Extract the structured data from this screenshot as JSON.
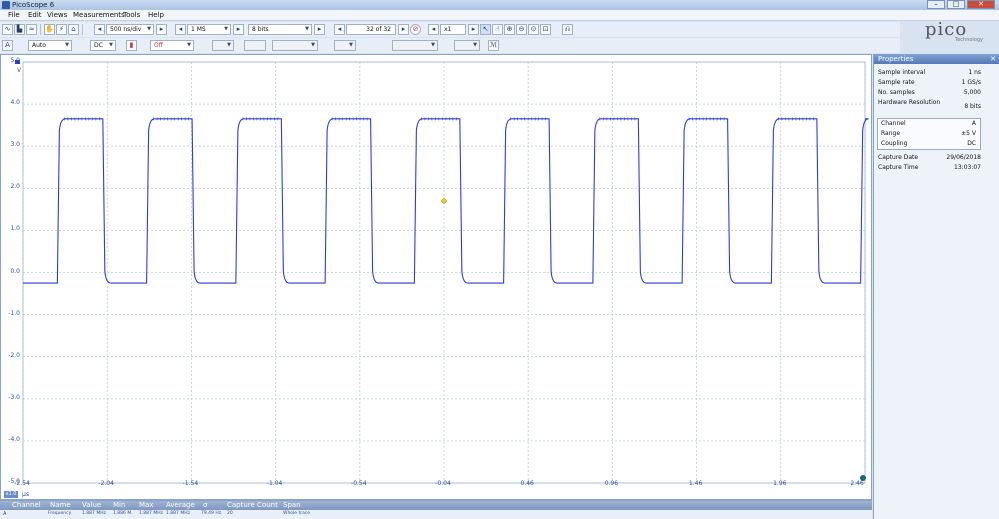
{
  "window": {
    "title": "PicoScope 6"
  },
  "menu": {
    "items": [
      "File",
      "Edit",
      "Views",
      "Measurements",
      "Tools",
      "Help"
    ]
  },
  "logo": {
    "text": "pico",
    "sub": "Technology"
  },
  "toolbar": {
    "timebase": "500 ns/div",
    "samples": "1 MS",
    "resolution": "8 bits",
    "buffer": "32 of 32",
    "zoom": "x1"
  },
  "channel_bar": {
    "channel": "A",
    "range": "Auto",
    "coupling": "DC",
    "trigger": "Off"
  },
  "properties": {
    "title": "Properties",
    "rows": [
      {
        "label": "Sample interval",
        "value": "1 ns"
      },
      {
        "label": "Sample rate",
        "value": "1 GS/s"
      },
      {
        "label": "No. samples",
        "value": "5,000"
      },
      {
        "label": "Hardware Resolution",
        "value": "8 bits"
      }
    ],
    "channel_box": [
      {
        "label": "Channel",
        "value": "A"
      },
      {
        "label": "Range",
        "value": "±5 V"
      },
      {
        "label": "Coupling",
        "value": "DC"
      }
    ],
    "capture": [
      {
        "label": "Capture Date",
        "value": "29/06/2018"
      },
      {
        "label": "Capture Time",
        "value": "13:03:07"
      }
    ]
  },
  "measurements": {
    "headers": [
      "Channel",
      "Name",
      "Value",
      "Min",
      "Max",
      "Average",
      "σ",
      "Capture Count",
      "Span"
    ],
    "row": [
      "A",
      "Frequency",
      "1.887 MHz",
      "1.886 M.",
      "1.887 MHz",
      "1.887 MHz",
      "79.49 Hz",
      "20",
      "Whole trace"
    ]
  },
  "axis": {
    "y_unit": "V",
    "x_unit": "µs",
    "zoom_tag": "x1.0",
    "yticks": [
      "5.0",
      "4.0",
      "3.0",
      "2.0",
      "1.0",
      "0.0",
      "-1.0",
      "-2.0",
      "-3.0",
      "-4.0",
      "-5.0"
    ],
    "xticks": [
      "-2.54",
      "-2.04",
      "-1.54",
      "-1.04",
      "-0.54",
      "-0.04",
      "0.46",
      "0.96",
      "1.46",
      "1.96",
      "2.46"
    ]
  },
  "colors": {
    "trace": "#2a3ed6",
    "grid": "#b7d3d1",
    "trigger": "#e8c838"
  },
  "chart_data": {
    "type": "line",
    "series": [
      {
        "name": "A",
        "high": 3.65,
        "low": -0.25,
        "frequency_mhz": 1.887,
        "rising_edges_us": [
          -2.33,
          -1.8,
          -1.27,
          -0.74,
          -0.21,
          0.32,
          0.85,
          1.38,
          1.91,
          2.44
        ],
        "falling_edges_us": [
          -2.06,
          -1.53,
          -1.0,
          -0.47,
          0.06,
          0.59,
          1.12,
          1.65,
          2.18
        ]
      }
    ],
    "xlim": [
      -2.54,
      2.46
    ],
    "ylim": [
      -5.0,
      5.0
    ],
    "ylabel": "V",
    "xlabel": "µs",
    "grid": true,
    "trigger_point": {
      "x": -0.04,
      "y": 1.7
    }
  }
}
